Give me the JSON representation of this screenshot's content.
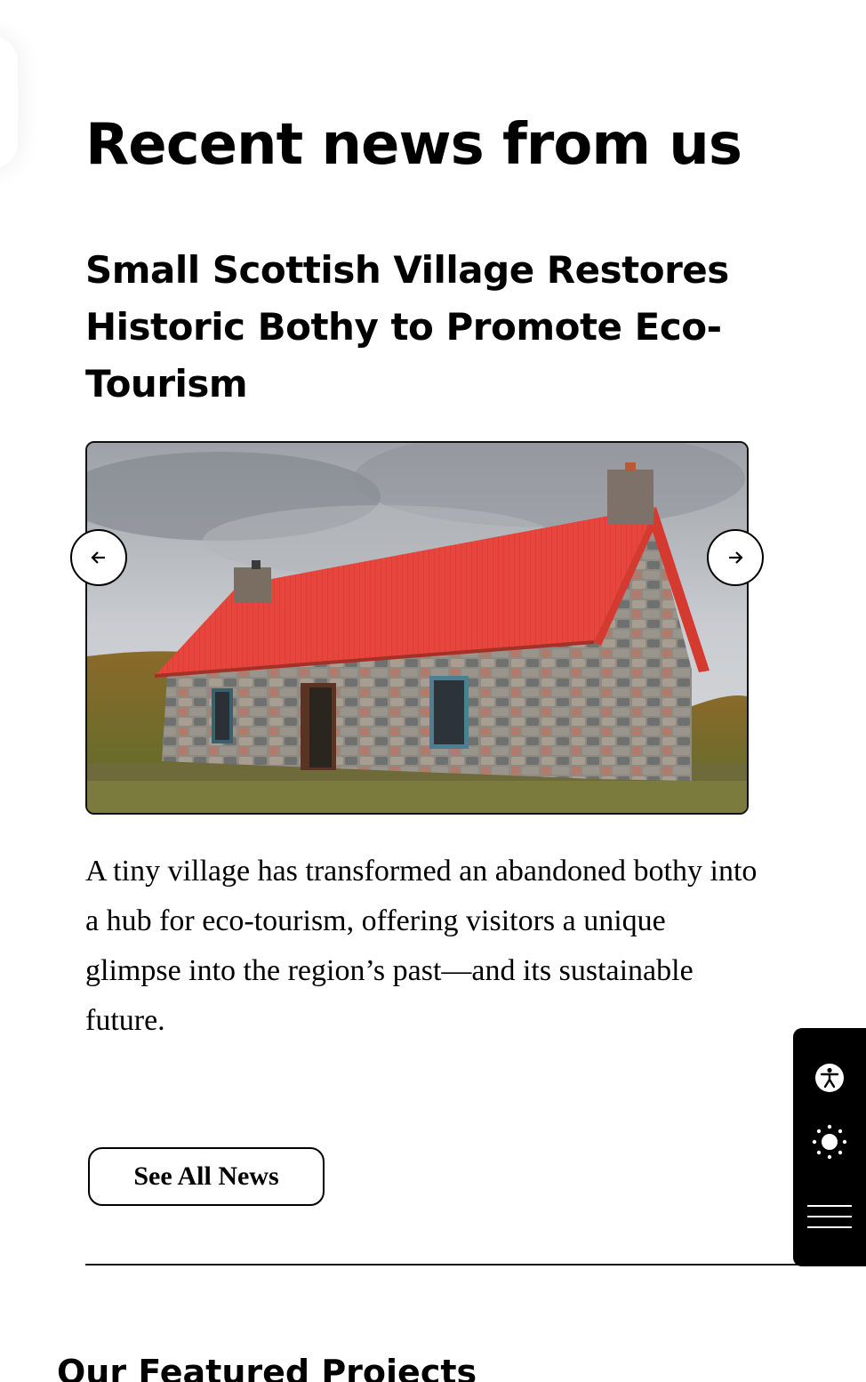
{
  "news": {
    "section_title": "Recent news from us",
    "article_title": "Small Scottish Village Restores Historic Bothy to Promote Eco-Tourism",
    "image_alt": "Stone bothy with red corrugated roof on moorland",
    "summary": "A tiny village has transformed an abandoned bothy into a hub for eco-tourism, offering visitors a unique glimpse into the region’s past—and its sustainable future.",
    "see_all_label": "See All News",
    "prev_icon": "arrow-left-icon",
    "next_icon": "arrow-right-icon"
  },
  "next_section": {
    "title": "Our Featured Projects"
  },
  "accessibility_toolbar": {
    "icons": [
      "accessibility-icon",
      "brightness-icon",
      "menu-icon"
    ]
  },
  "colors": {
    "text": "#000000",
    "background": "#ffffff",
    "roof": "#e8453c",
    "toolbar": "#000000"
  }
}
